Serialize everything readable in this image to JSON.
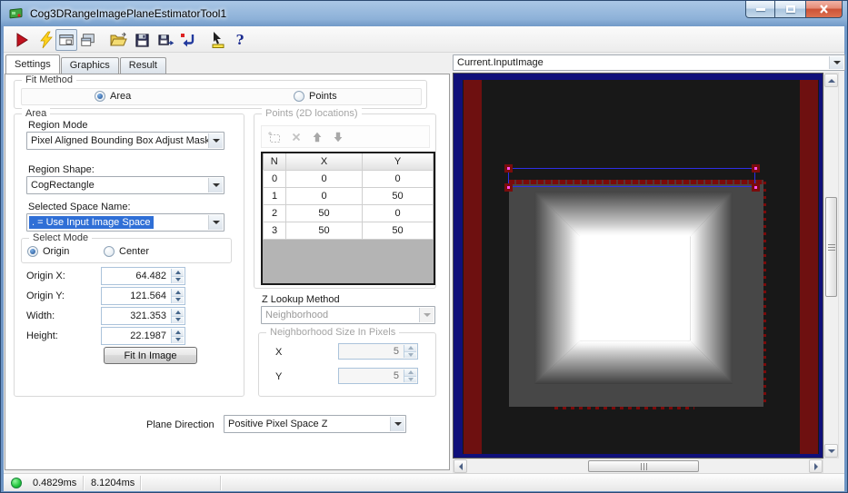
{
  "window": {
    "title": "Cog3DRangeImagePlaneEstimatorTool1"
  },
  "toolbar": {
    "buttons": [
      "run",
      "electric-run",
      "show-image-display",
      "float-display",
      "open",
      "save",
      "save-as",
      "reset",
      "probe",
      "help"
    ],
    "help_glyph": "?"
  },
  "tabs": [
    {
      "label": "Settings"
    },
    {
      "label": "Graphics"
    },
    {
      "label": "Result"
    }
  ],
  "fit_method": {
    "label": "Fit Method",
    "area_option": "Area",
    "points_option": "Points"
  },
  "area": {
    "label": "Area",
    "region_mode_label": "Region Mode",
    "region_mode_value": "Pixel Aligned Bounding Box Adjust Mask",
    "region_shape_label": "Region Shape:",
    "region_shape_value": "CogRectangle",
    "selected_space_label": "Selected Space Name:",
    "selected_space_value": ". = Use Input Image Space",
    "select_mode_label": "Select Mode",
    "origin_option": "Origin",
    "center_option": "Center",
    "origin_x_label": "Origin X:",
    "origin_x_value": "64.482",
    "origin_y_label": "Origin Y:",
    "origin_y_value": "121.564",
    "width_label": "Width:",
    "width_value": "321.353",
    "height_label": "Height:",
    "height_value": "22.1987",
    "fit_button_label": "Fit In Image"
  },
  "points": {
    "label": "Points (2D locations)",
    "toolbar_icons": [
      "add-point",
      "delete-point",
      "move-up",
      "move-down"
    ],
    "table": {
      "headers": [
        "N",
        "X",
        "Y"
      ],
      "rows": [
        [
          "0",
          "0",
          "0"
        ],
        [
          "1",
          "0",
          "50"
        ],
        [
          "2",
          "50",
          "0"
        ],
        [
          "3",
          "50",
          "50"
        ]
      ]
    },
    "z_lookup_label": "Z Lookup Method",
    "z_lookup_value": "Neighborhood",
    "neighborhood_label": "Neighborhood Size In Pixels",
    "x_label": "X",
    "x_value": "5",
    "y_label": "Y",
    "y_value": "5"
  },
  "plane_direction": {
    "label": "Plane Direction",
    "value": "Positive Pixel Space Z"
  },
  "display": {
    "source": "Current.InputImage"
  },
  "status": {
    "time1": "0.4829ms",
    "time2": "8.1204ms"
  },
  "colors": {
    "selection_blue": "#2f6fd6",
    "display_navy": "#10107a",
    "mask_red": "#6e1010",
    "roi_blue": "#2e2ee6",
    "handle_magenta": "#ff4df2",
    "status_green": "#22c53c"
  }
}
